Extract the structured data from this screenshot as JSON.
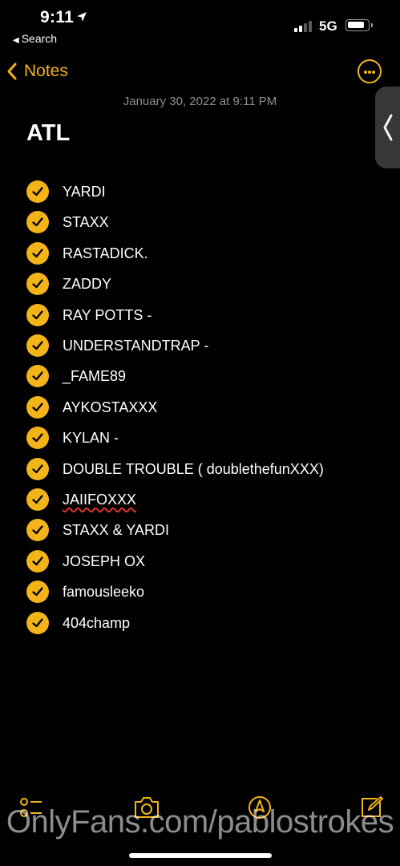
{
  "status_bar": {
    "time": "9:11",
    "back_app": "Search",
    "network": "5G",
    "signal_bars": 2,
    "battery_level": 0.85
  },
  "nav": {
    "back_label": "Notes",
    "accent_color": "#f2b419"
  },
  "note": {
    "date": "January 30, 2022 at 9:11 PM",
    "title": "ATL",
    "items": [
      {
        "text": "YARDI",
        "checked": true
      },
      {
        "text": "STAXX",
        "checked": true
      },
      {
        "text": "RASTADICK.",
        "checked": true
      },
      {
        "text": "ZADDY",
        "checked": true
      },
      {
        "text": "RAY POTTS -",
        "checked": true
      },
      {
        "text": "UNDERSTANDTRAP -",
        "checked": true
      },
      {
        "text": "_FAME89",
        "checked": true
      },
      {
        "text": "AYKOSTAXXX",
        "checked": true
      },
      {
        "text": "KYLAN -",
        "checked": true
      },
      {
        "text": "DOUBLE TROUBLE ( doublethefunXXX)",
        "checked": true
      },
      {
        "text": "JAIIFOXXX",
        "checked": true,
        "spellcheck_flag": true
      },
      {
        "text": "STAXX & YARDI",
        "checked": true
      },
      {
        "text": "JOSEPH OX",
        "checked": true
      },
      {
        "text": "famousleeko",
        "checked": true
      },
      {
        "text": "404champ",
        "checked": true
      }
    ]
  },
  "toolbar": {
    "icons": [
      "checklist-icon",
      "camera-icon",
      "markup-pen-icon",
      "compose-icon"
    ]
  },
  "watermark": "OnlyFans.com/pablostrokes"
}
